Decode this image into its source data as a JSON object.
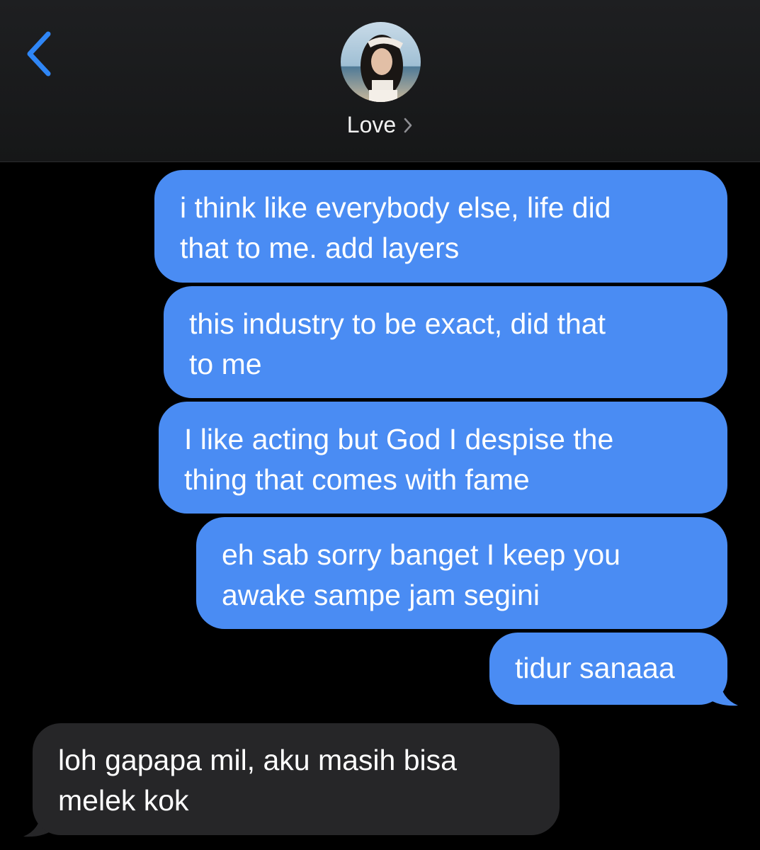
{
  "header": {
    "back_icon": "chevron-left-icon",
    "contact_name": "Love",
    "name_chevron_icon": "chevron-right-icon",
    "avatar_icon": "contact-photo"
  },
  "colors": {
    "accent": "#2f86f6",
    "sent_bubble": "#4a8cf3",
    "received_bubble": "#262628",
    "background": "#000000",
    "header_background": "#1b1c1e"
  },
  "messages": [
    {
      "direction": "sent",
      "lines": [
        "i think like everybody else, life did",
        "that to me. add layers"
      ]
    },
    {
      "direction": "sent",
      "lines": [
        "this industry to be exact, did that",
        "to me"
      ]
    },
    {
      "direction": "sent",
      "lines": [
        "I like acting but God I despise the",
        "thing that comes with fame"
      ]
    },
    {
      "direction": "sent",
      "lines": [
        "eh sab sorry banget I keep you",
        "awake sampe jam segini"
      ]
    },
    {
      "direction": "sent",
      "lines": [
        "tidur sanaaa"
      ]
    },
    {
      "direction": "received",
      "lines": [
        "loh gapapa mil, aku masih bisa",
        "melek kok"
      ]
    }
  ]
}
